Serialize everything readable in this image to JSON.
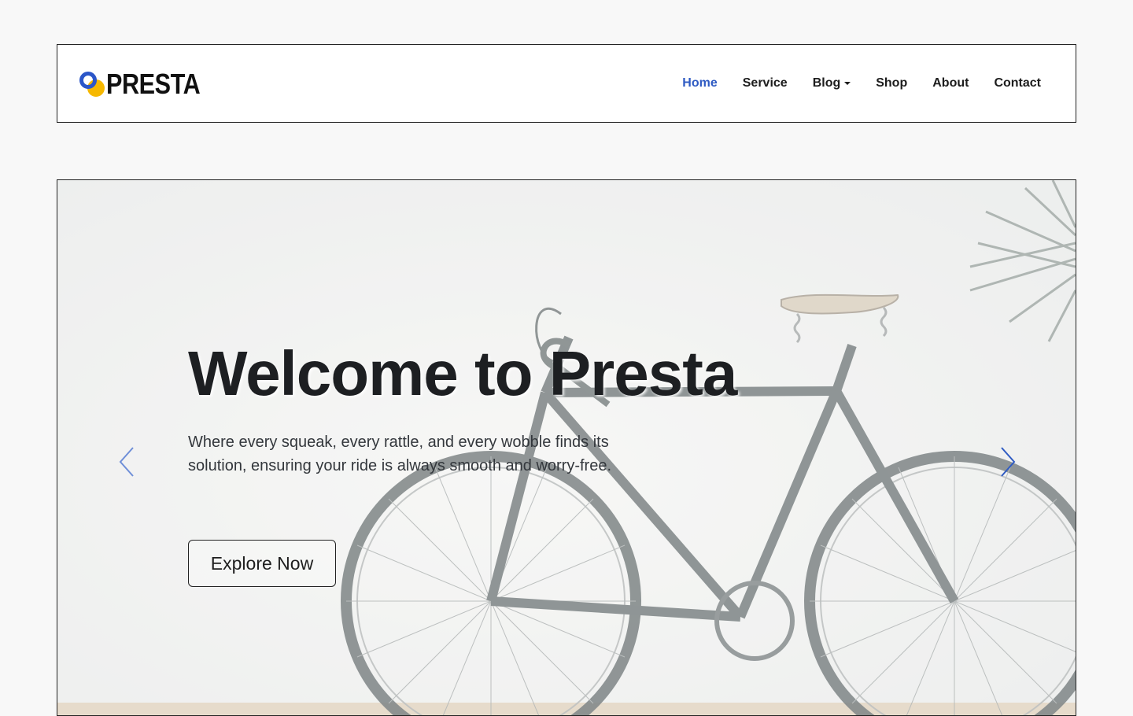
{
  "header": {
    "logo_text": "PRESTA",
    "nav": [
      {
        "label": "Home",
        "active": true
      },
      {
        "label": "Service"
      },
      {
        "label": "Blog",
        "dropdown": true
      },
      {
        "label": "Shop"
      },
      {
        "label": "About"
      },
      {
        "label": "Contact"
      }
    ]
  },
  "hero": {
    "title": "Welcome to Presta",
    "subtitle": "Where every squeak, every rattle, and every wobble finds its solution, ensuring your ride is always smooth and worry-free.",
    "cta_label": "Explore Now",
    "prev_icon": "chevron-left-icon",
    "next_icon": "chevron-right-icon",
    "background_image": "bicycle-against-wall"
  },
  "colors": {
    "accent": "#2f5bc3",
    "logo_blue": "#2b56c8",
    "logo_yellow": "#f6b800",
    "page_bg": "#f8f8f8"
  }
}
